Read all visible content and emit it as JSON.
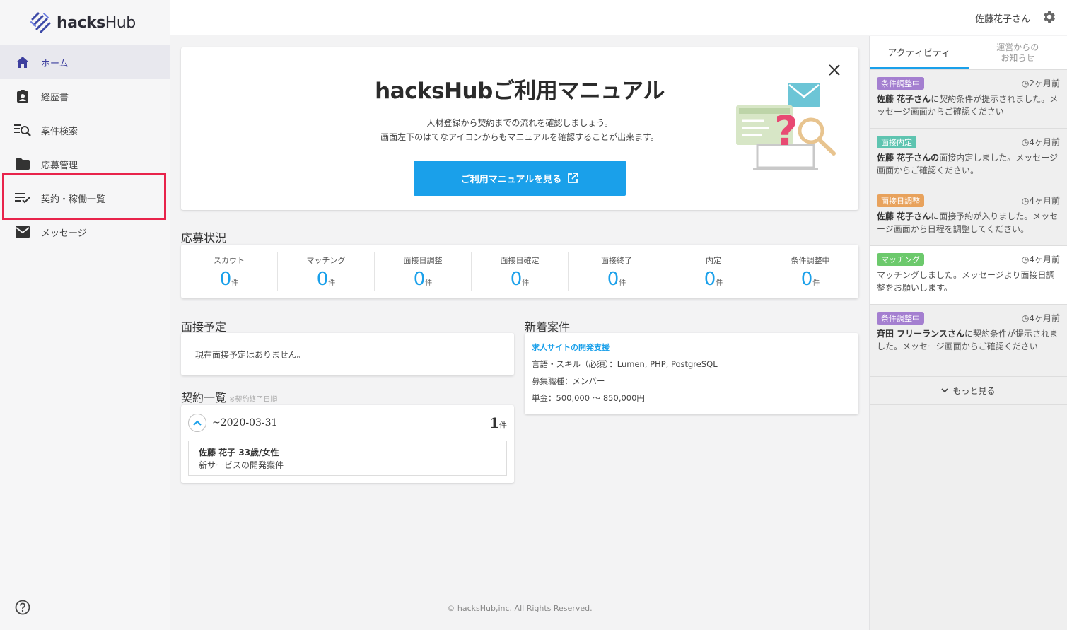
{
  "app": {
    "logo_text_bold": "hacks",
    "logo_text_light": "Hub",
    "user_name": "佐藤花子さん"
  },
  "sidebar": {
    "items": [
      {
        "label": "ホーム",
        "icon": "home-icon",
        "active": true
      },
      {
        "label": "経歴書",
        "icon": "profile-card-icon"
      },
      {
        "label": "案件検索",
        "icon": "list-search-icon"
      },
      {
        "label": "応募管理",
        "icon": "folder-icon"
      },
      {
        "label": "契約・稼働一覧",
        "icon": "checklist-icon",
        "highlighted": true
      },
      {
        "label": "メッセージ",
        "icon": "mail-icon"
      }
    ]
  },
  "manual": {
    "title": "hacksHubご利用マニュアル",
    "sub1": "人材登録から契約までの流れを確認しましょう。",
    "sub2": "画面左下のはてなアイコンからもマニュアルを確認することが出来ます。",
    "button_label": "ご利用マニュアルを見る"
  },
  "status": {
    "title": "応募状況",
    "unit": "件",
    "cells": [
      {
        "label": "スカウト",
        "value": "0"
      },
      {
        "label": "マッチング",
        "value": "0"
      },
      {
        "label": "面接日調整",
        "value": "0"
      },
      {
        "label": "面接日確定",
        "value": "0"
      },
      {
        "label": "面接終了",
        "value": "0"
      },
      {
        "label": "内定",
        "value": "0"
      },
      {
        "label": "条件調整中",
        "value": "0"
      }
    ]
  },
  "interview": {
    "title": "面接予定",
    "empty_text": "現在面接予定はありません。"
  },
  "contracts": {
    "title": "契約一覧",
    "note": "※契約終了日順",
    "group_date": "~2020-03-31",
    "count": "1",
    "count_unit": "件",
    "item_name": "佐藤 花子 33歳/女性",
    "item_desc": "新サービスの開発案件"
  },
  "newjobs": {
    "title": "新着案件",
    "job_title": "求人サイトの開発支援",
    "skills": "言語・スキル（必須）：Lumen, PHP, PostgreSQL",
    "role": "募集職種：メンバー",
    "price": "単金：500,000 ～ 850,000円"
  },
  "footer": "© hacksHub,inc. All Rights Reserved.",
  "rpanel": {
    "tab_activity": "アクティビティ",
    "tab_news_line1": "運営からの",
    "tab_news_line2": "お知らせ",
    "more_label": "もっと見る",
    "colors": {
      "purple": "#a47fd0",
      "teal": "#5ec4b0",
      "orange": "#e8a25c",
      "green": "#6cc96c"
    },
    "activities": [
      {
        "badge": "条件調整中",
        "time": "2ヶ月前",
        "name": "佐藤 花子さん",
        "text": "に契約条件が提示されました。メッセージ画面からご確認ください"
      },
      {
        "badge": "面接内定",
        "time": "4ヶ月前",
        "name": "佐藤 花子さんの",
        "text": "面接内定しました。メッセージ画面からご確認ください。"
      },
      {
        "badge": "面接日調整",
        "time": "4ヶ月前",
        "name": "佐藤 花子さん",
        "text": "に面接予約が入りました。メッセージ画面から日程を調整してください。"
      },
      {
        "badge": "マッチング",
        "time": "4ヶ月前",
        "name": "",
        "text": "マッチングしました。メッセージより面接日調整をお願いします。"
      },
      {
        "badge": "条件調整中",
        "time": "4ヶ月前",
        "name": "斉田 フリーランスさん",
        "text": "に契約条件が提示されました。メッセージ画面からご確認ください"
      }
    ]
  }
}
